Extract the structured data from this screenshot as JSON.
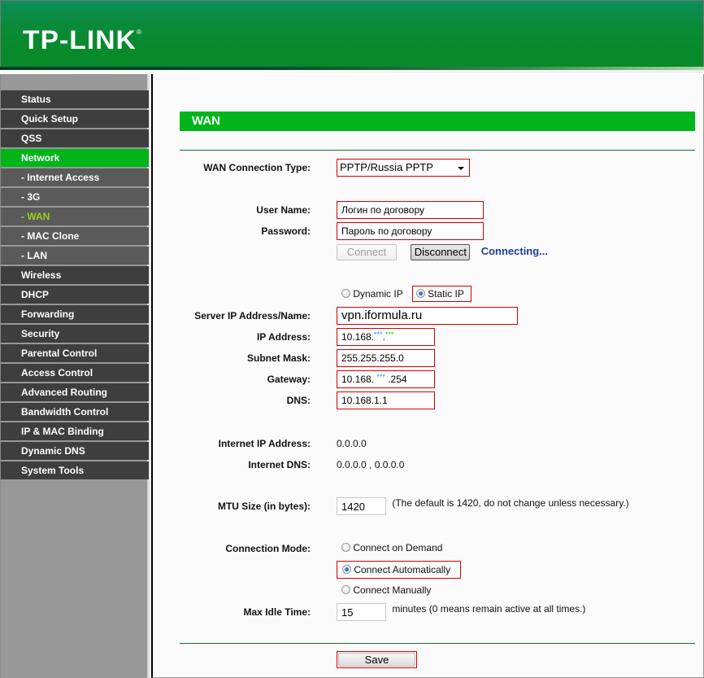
{
  "header": {
    "logo": "TP-LINK",
    "registered_mark": "®"
  },
  "sidebar": {
    "items": [
      {
        "label": "Status",
        "type": "main"
      },
      {
        "label": "Quick Setup",
        "type": "main"
      },
      {
        "label": "QSS",
        "type": "main"
      },
      {
        "label": "Network",
        "type": "main",
        "active": true
      },
      {
        "label": "- Internet Access",
        "type": "sub"
      },
      {
        "label": "- 3G",
        "type": "sub"
      },
      {
        "label": "- WAN",
        "type": "sub",
        "current": true
      },
      {
        "label": "- MAC Clone",
        "type": "sub"
      },
      {
        "label": "- LAN",
        "type": "sub"
      },
      {
        "label": "Wireless",
        "type": "main"
      },
      {
        "label": "DHCP",
        "type": "main"
      },
      {
        "label": "Forwarding",
        "type": "main"
      },
      {
        "label": "Security",
        "type": "main"
      },
      {
        "label": "Parental Control",
        "type": "main"
      },
      {
        "label": "Access Control",
        "type": "main"
      },
      {
        "label": "Advanced Routing",
        "type": "main"
      },
      {
        "label": "Bandwidth Control",
        "type": "main"
      },
      {
        "label": "IP & MAC Binding",
        "type": "main"
      },
      {
        "label": "Dynamic DNS",
        "type": "main"
      },
      {
        "label": "System Tools",
        "type": "main"
      }
    ]
  },
  "page": {
    "title": "WAN",
    "wan_connection_type": {
      "label": "WAN Connection Type:",
      "value": "PPTP/Russia PPTP"
    },
    "user_name": {
      "label": "User Name:",
      "value": "Логин по договору"
    },
    "password": {
      "label": "Password:",
      "value": "Пароль по договору"
    },
    "connect_button": "Connect",
    "disconnect_button": "Disconnect",
    "connection_status": "Connecting...",
    "ip_mode": {
      "options": [
        "Dynamic IP",
        "Static IP"
      ],
      "selected": "Static IP"
    },
    "server": {
      "label": "Server IP Address/Name:",
      "value": "vpn.iformula.ru"
    },
    "ip_address": {
      "label": "IP Address:",
      "prefix": "10.168.",
      "masked_1": "***",
      "separator": ".",
      "masked_2": "***"
    },
    "subnet_mask": {
      "label": "Subnet Mask:",
      "value": "255.255.255.0"
    },
    "gateway": {
      "label": "Gateway:",
      "prefix": "10.168. ",
      "masked": "***",
      "suffix": " .254"
    },
    "dns": {
      "label": "DNS:",
      "value": "10.168.1.1"
    },
    "internet_ip": {
      "label": "Internet IP Address:",
      "value": "0.0.0.0"
    },
    "internet_dns": {
      "label": "Internet DNS:",
      "value": "0.0.0.0 , 0.0.0.0"
    },
    "mtu": {
      "label": "MTU Size (in bytes):",
      "value": "1420",
      "note": "(The default is 1420, do not change unless necessary.)"
    },
    "connection_mode": {
      "label": "Connection Mode:",
      "options": [
        "Connect on Demand",
        "Connect Automatically",
        "Connect Manually"
      ],
      "selected": "Connect Automatically"
    },
    "max_idle": {
      "label": "Max Idle Time:",
      "value": "15",
      "note": "minutes (0 means remain active at all times.)"
    },
    "save_button": "Save"
  },
  "colors": {
    "brand_green": "#00b51a",
    "header_green": "#078a2a",
    "highlight_red": "#d40000",
    "status_blue": "#1f3f9e",
    "sidebar_dark": "#3e3e3e",
    "sidebar_sub": "#5a5a5a",
    "current_item": "#9bd21c"
  }
}
